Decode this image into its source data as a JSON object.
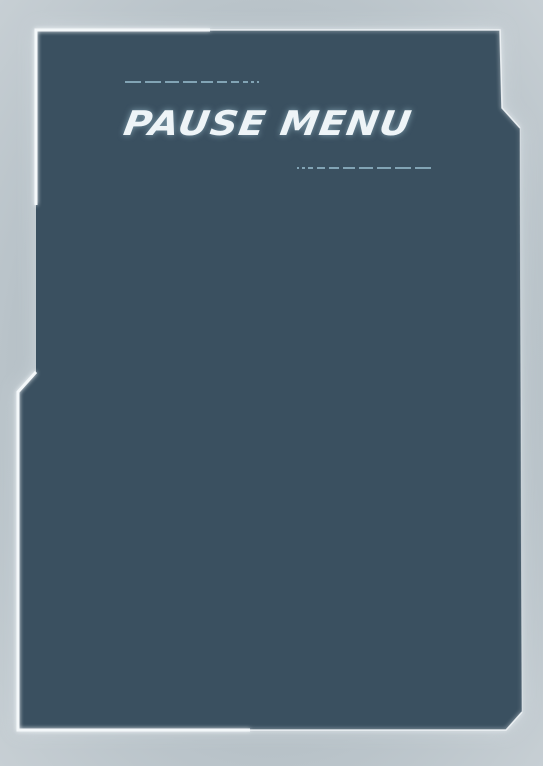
{
  "pause_menu": {
    "title": "Pause Menu"
  },
  "colors": {
    "panel_fill": "#3a5060",
    "panel_border": "#f2f6f8",
    "title_text": "#eef4f7",
    "accent_dash": "#8fb3c4",
    "backdrop": "#b8c2c8"
  }
}
